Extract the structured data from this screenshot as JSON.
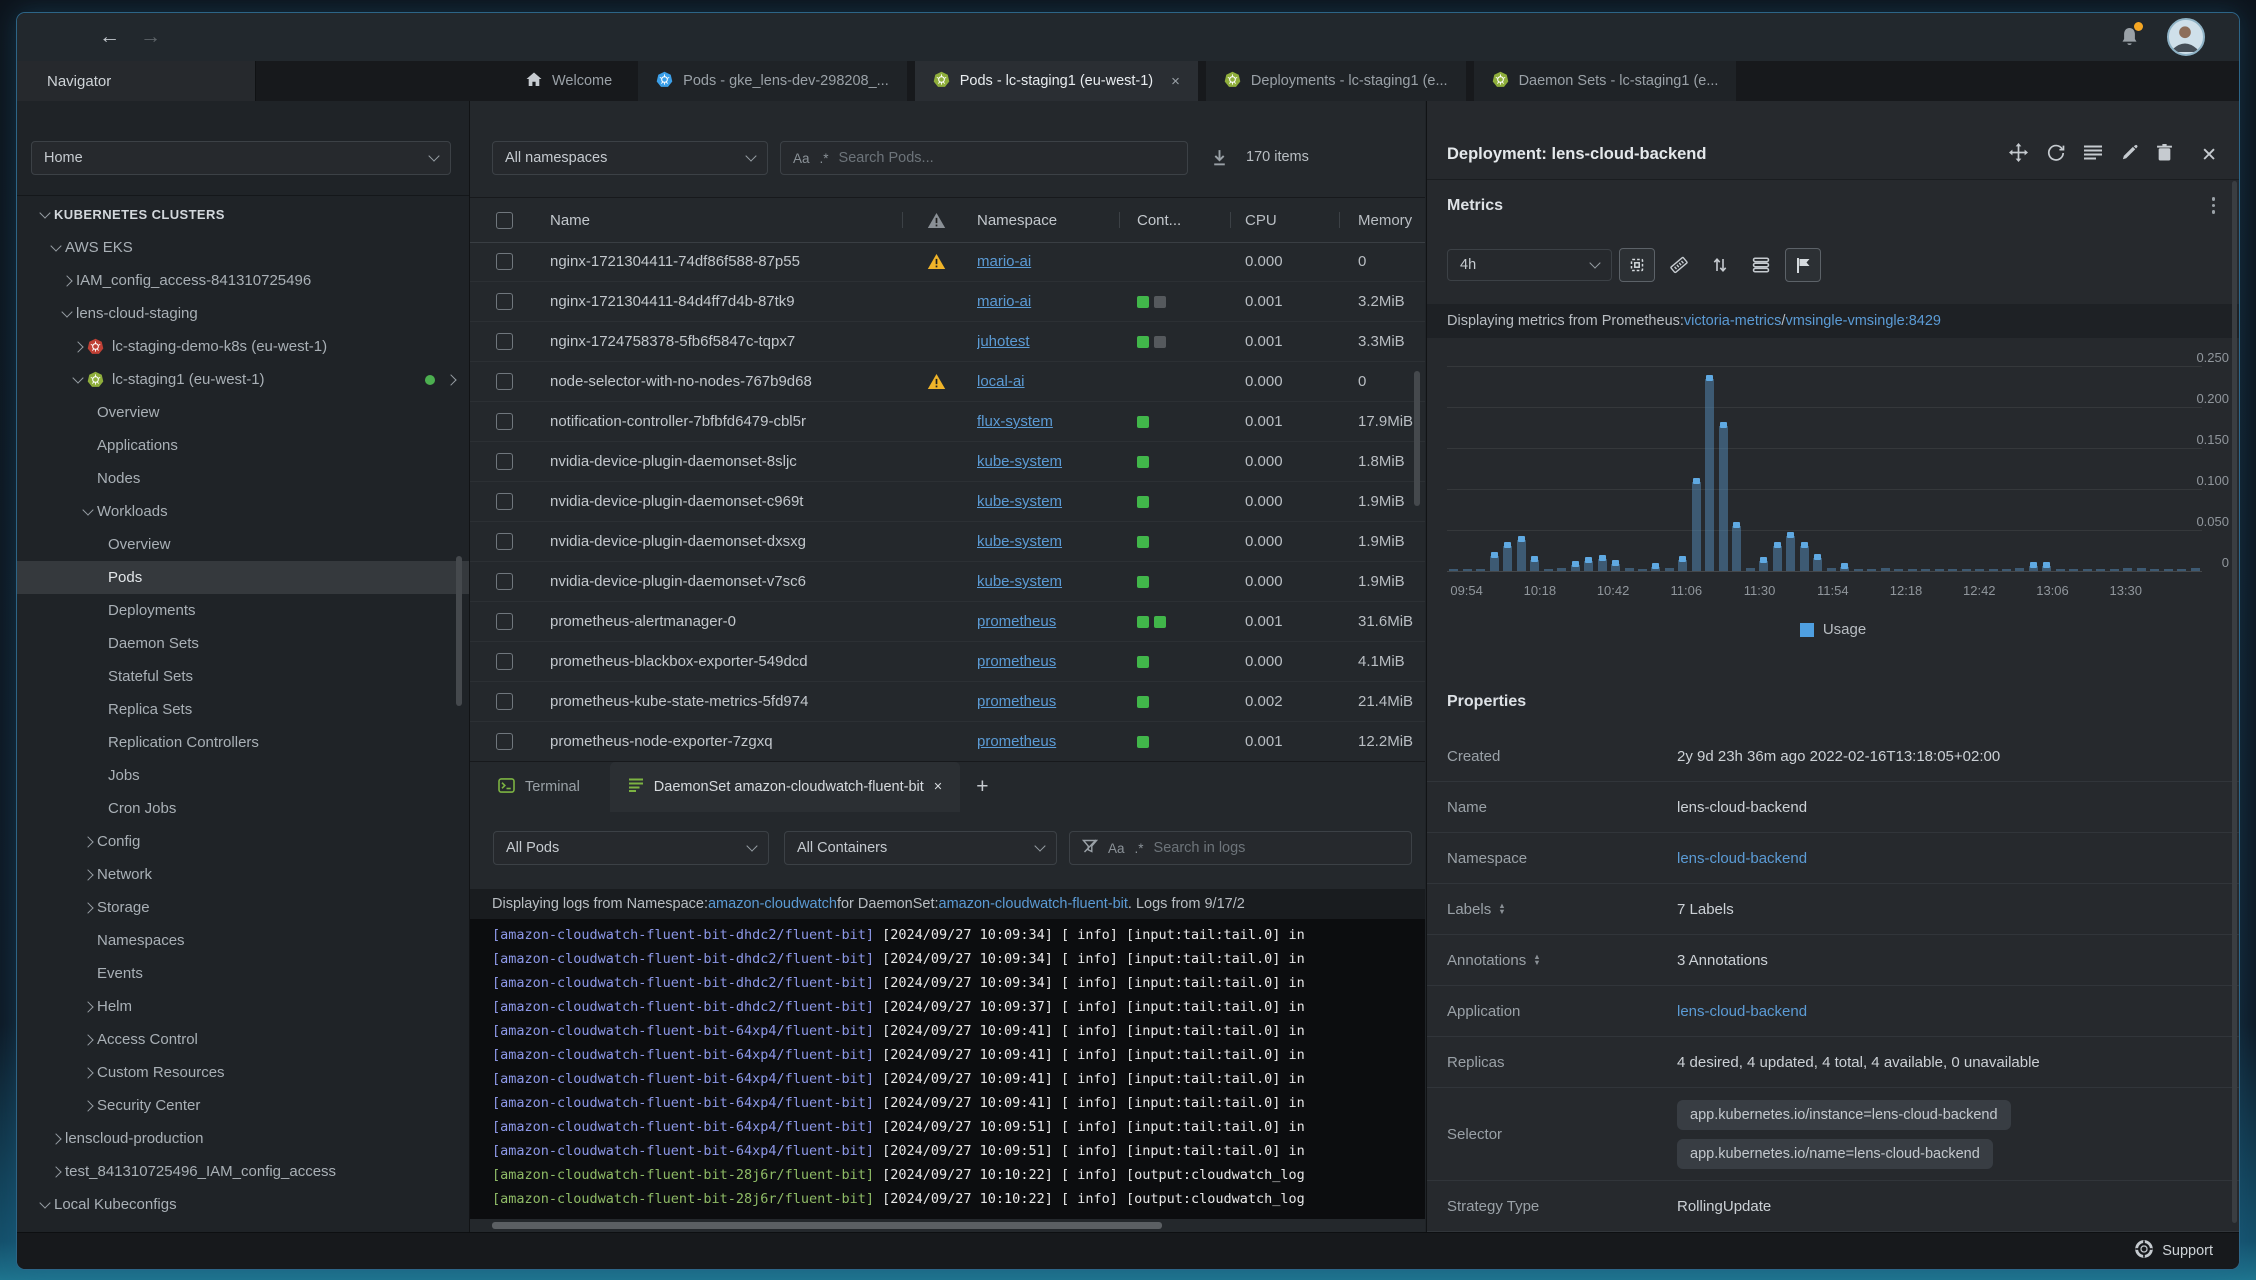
{
  "tabbar": {
    "navigator_label": "Navigator",
    "tabs": [
      {
        "label": "Welcome",
        "icon": "home",
        "icon_color": "#c6cbd0",
        "active": false,
        "closable": false,
        "plain": true
      },
      {
        "label": "Pods - gke_lens-dev-298208_...",
        "icon": "k8s",
        "icon_color": "#3b9fe8",
        "active": false,
        "closable": false,
        "plain": false
      },
      {
        "label": "Pods - lc-staging1 (eu-west-1)",
        "icon": "k8s",
        "icon_color": "#8fae3c",
        "active": true,
        "closable": true,
        "plain": false
      },
      {
        "label": "Deployments - lc-staging1 (e...",
        "icon": "k8s",
        "icon_color": "#8fae3c",
        "active": false,
        "closable": false,
        "plain": false
      },
      {
        "label": "Daemon Sets - lc-staging1 (e...",
        "icon": "k8s",
        "icon_color": "#8fae3c",
        "active": false,
        "closable": false,
        "plain": false
      }
    ]
  },
  "sidebar": {
    "selector_value": "Home",
    "tree": [
      {
        "label": "KUBERNETES CLUSTERS",
        "level": 0,
        "chevron": "down",
        "section": true
      },
      {
        "label": "AWS EKS",
        "level": 1,
        "chevron": "down"
      },
      {
        "label": "IAM_config_access-841310725496",
        "level": 2,
        "chevron": "right"
      },
      {
        "label": "lens-cloud-staging",
        "level": 2,
        "chevron": "down"
      },
      {
        "label": "lc-staging-demo-k8s (eu-west-1)",
        "level": 3,
        "chevron": "right",
        "icon": "k8s",
        "icon_color": "#bf4136"
      },
      {
        "label": "lc-staging1 (eu-west-1)",
        "level": 3,
        "chevron": "down",
        "icon": "k8s",
        "icon_color": "#8fae3c",
        "status_dot": "#4caf50",
        "trailing_chevron": true
      },
      {
        "label": "Overview",
        "level": 4
      },
      {
        "label": "Applications",
        "level": 4
      },
      {
        "label": "Nodes",
        "level": 4
      },
      {
        "label": "Workloads",
        "level": 4,
        "chevron": "down"
      },
      {
        "label": "Overview",
        "level": 5
      },
      {
        "label": "Pods",
        "level": 5,
        "selected": true
      },
      {
        "label": "Deployments",
        "level": 5
      },
      {
        "label": "Daemon Sets",
        "level": 5
      },
      {
        "label": "Stateful Sets",
        "level": 5
      },
      {
        "label": "Replica Sets",
        "level": 5
      },
      {
        "label": "Replication Controllers",
        "level": 5
      },
      {
        "label": "Jobs",
        "level": 5
      },
      {
        "label": "Cron Jobs",
        "level": 5
      },
      {
        "label": "Config",
        "level": 4,
        "chevron": "right"
      },
      {
        "label": "Network",
        "level": 4,
        "chevron": "right"
      },
      {
        "label": "Storage",
        "level": 4,
        "chevron": "right"
      },
      {
        "label": "Namespaces",
        "level": 4
      },
      {
        "label": "Events",
        "level": 4
      },
      {
        "label": "Helm",
        "level": 4,
        "chevron": "right"
      },
      {
        "label": "Access Control",
        "level": 4,
        "chevron": "right"
      },
      {
        "label": "Custom Resources",
        "level": 4,
        "chevron": "right"
      },
      {
        "label": "Security Center",
        "level": 4,
        "chevron": "right"
      },
      {
        "label": "lenscloud-production",
        "level": 1,
        "chevron": "right"
      },
      {
        "label": "test_841310725496_IAM_config_access",
        "level": 1,
        "chevron": "right"
      },
      {
        "label": "Local Kubeconfigs",
        "level": 0,
        "chevron": "down"
      }
    ]
  },
  "pods_panel": {
    "namespace_filter": "All namespaces",
    "match_case_label": "Aa",
    "regex_label": ".*",
    "search_placeholder": "Search Pods...",
    "items_count": "170 items",
    "columns": {
      "name": "Name",
      "namespace": "Namespace",
      "containers": "Cont...",
      "cpu": "CPU",
      "memory": "Memory"
    },
    "rows": [
      {
        "name": "nginx-1721304411-74df86f588-87p55",
        "warning": true,
        "namespace": "mario-ai",
        "containers": [],
        "cpu": "0.000",
        "memory": "0"
      },
      {
        "name": "nginx-1721304411-84d4ff7d4b-87tk9",
        "warning": false,
        "namespace": "mario-ai",
        "containers": [
          "green",
          "gray"
        ],
        "cpu": "0.001",
        "memory": "3.2MiB"
      },
      {
        "name": "nginx-1724758378-5fb6f5847c-tqpx7",
        "warning": false,
        "namespace": "juhotest",
        "containers": [
          "green",
          "gray"
        ],
        "cpu": "0.001",
        "memory": "3.3MiB"
      },
      {
        "name": "node-selector-with-no-nodes-767b9d68",
        "warning": true,
        "namespace": "local-ai",
        "containers": [],
        "cpu": "0.000",
        "memory": "0"
      },
      {
        "name": "notification-controller-7bfbfd6479-cbl5r",
        "warning": false,
        "namespace": "flux-system",
        "containers": [
          "green"
        ],
        "cpu": "0.001",
        "memory": "17.9MiB"
      },
      {
        "name": "nvidia-device-plugin-daemonset-8sljc",
        "warning": false,
        "namespace": "kube-system",
        "containers": [
          "green"
        ],
        "cpu": "0.000",
        "memory": "1.8MiB"
      },
      {
        "name": "nvidia-device-plugin-daemonset-c969t",
        "warning": false,
        "namespace": "kube-system",
        "containers": [
          "green"
        ],
        "cpu": "0.000",
        "memory": "1.9MiB"
      },
      {
        "name": "nvidia-device-plugin-daemonset-dxsxg",
        "warning": false,
        "namespace": "kube-system",
        "containers": [
          "green"
        ],
        "cpu": "0.000",
        "memory": "1.9MiB"
      },
      {
        "name": "nvidia-device-plugin-daemonset-v7sc6",
        "warning": false,
        "namespace": "kube-system",
        "containers": [
          "green"
        ],
        "cpu": "0.000",
        "memory": "1.9MiB"
      },
      {
        "name": "prometheus-alertmanager-0",
        "warning": false,
        "namespace": "prometheus",
        "containers": [
          "green",
          "green"
        ],
        "cpu": "0.001",
        "memory": "31.6MiB"
      },
      {
        "name": "prometheus-blackbox-exporter-549dcd",
        "warning": false,
        "namespace": "prometheus",
        "containers": [
          "green"
        ],
        "cpu": "0.000",
        "memory": "4.1MiB"
      },
      {
        "name": "prometheus-kube-state-metrics-5fd974",
        "warning": false,
        "namespace": "prometheus",
        "containers": [
          "green"
        ],
        "cpu": "0.002",
        "memory": "21.4MiB"
      },
      {
        "name": "prometheus-node-exporter-7zgxq",
        "warning": false,
        "namespace": "prometheus",
        "containers": [
          "green"
        ],
        "cpu": "0.001",
        "memory": "12.2MiB"
      }
    ]
  },
  "dock": {
    "tabs": [
      {
        "label": "Terminal",
        "icon": "terminal",
        "active": false,
        "closable": false
      },
      {
        "label": "DaemonSet amazon-cloudwatch-fluent-bit",
        "icon": "logs",
        "active": true,
        "closable": true
      }
    ],
    "new_tab_label": "+",
    "pods_filter": "All Pods",
    "containers_filter": "All Containers",
    "match_case_label": "Aa",
    "regex_label": ".*",
    "search_placeholder": "Search in logs",
    "info": {
      "prefix": "Displaying logs from Namespace: ",
      "namespace_link": "amazon-cloudwatch",
      "middle": " for DaemonSet: ",
      "daemonset_link": "amazon-cloudwatch-fluent-bit",
      "suffix": ". Logs from 9/17/2"
    },
    "log_lines": [
      {
        "pod": "[amazon-cloudwatch-fluent-bit-dhdc2/fluent-bit]",
        "pod_color": "#8d98e8",
        "message": " [2024/09/27 10:09:34] [ info] [input:tail:tail.0] in"
      },
      {
        "pod": "[amazon-cloudwatch-fluent-bit-dhdc2/fluent-bit]",
        "pod_color": "#8d98e8",
        "message": " [2024/09/27 10:09:34] [ info] [input:tail:tail.0] in"
      },
      {
        "pod": "[amazon-cloudwatch-fluent-bit-dhdc2/fluent-bit]",
        "pod_color": "#8d98e8",
        "message": " [2024/09/27 10:09:34] [ info] [input:tail:tail.0] in"
      },
      {
        "pod": "[amazon-cloudwatch-fluent-bit-dhdc2/fluent-bit]",
        "pod_color": "#8d98e8",
        "message": " [2024/09/27 10:09:37] [ info] [input:tail:tail.0] in"
      },
      {
        "pod": "[amazon-cloudwatch-fluent-bit-64xp4/fluent-bit]",
        "pod_color": "#8d98e8",
        "message": " [2024/09/27 10:09:41] [ info] [input:tail:tail.0] in"
      },
      {
        "pod": "[amazon-cloudwatch-fluent-bit-64xp4/fluent-bit]",
        "pod_color": "#8d98e8",
        "message": " [2024/09/27 10:09:41] [ info] [input:tail:tail.0] in"
      },
      {
        "pod": "[amazon-cloudwatch-fluent-bit-64xp4/fluent-bit]",
        "pod_color": "#8d98e8",
        "message": " [2024/09/27 10:09:41] [ info] [input:tail:tail.0] in"
      },
      {
        "pod": "[amazon-cloudwatch-fluent-bit-64xp4/fluent-bit]",
        "pod_color": "#8d98e8",
        "message": " [2024/09/27 10:09:41] [ info] [input:tail:tail.0] in"
      },
      {
        "pod": "[amazon-cloudwatch-fluent-bit-64xp4/fluent-bit]",
        "pod_color": "#8d98e8",
        "message": " [2024/09/27 10:09:51] [ info] [input:tail:tail.0] in"
      },
      {
        "pod": "[amazon-cloudwatch-fluent-bit-64xp4/fluent-bit]",
        "pod_color": "#8d98e8",
        "message": " [2024/09/27 10:09:51] [ info] [input:tail:tail.0] in"
      },
      {
        "pod": "[amazon-cloudwatch-fluent-bit-28j6r/fluent-bit]",
        "pod_color": "#8fbb66",
        "message": " [2024/09/27 10:10:22] [ info] [output:cloudwatch_log"
      },
      {
        "pod": "[amazon-cloudwatch-fluent-bit-28j6r/fluent-bit]",
        "pod_color": "#8fbb66",
        "message": " [2024/09/27 10:10:22] [ info] [output:cloudwatch_log"
      }
    ]
  },
  "details": {
    "title": "Deployment: lens-cloud-backend",
    "metrics": {
      "heading": "Metrics",
      "time_range": "4h",
      "source": {
        "prefix": "Displaying metrics from Prometheus: ",
        "provider_link": "victoria-metrics",
        "separator": " / ",
        "endpoint_link": "vmsingle-vmsingle:8429"
      },
      "legend_label": "Usage"
    },
    "properties": {
      "heading": "Properties",
      "rows": [
        {
          "label": "Created",
          "value": "2y 9d 23h 36m ago 2022-02-16T13:18:05+02:00"
        },
        {
          "label": "Name",
          "value": "lens-cloud-backend"
        },
        {
          "label": "Namespace",
          "value": "lens-cloud-backend",
          "link": true
        },
        {
          "label": "Labels",
          "value": "7 Labels",
          "sortable": true
        },
        {
          "label": "Annotations",
          "value": "3 Annotations",
          "sortable": true
        },
        {
          "label": "Application",
          "value": "lens-cloud-backend",
          "link": true
        },
        {
          "label": "Replicas",
          "value": "4 desired, 4 updated, 4 total, 4 available, 0 unavailable"
        },
        {
          "label": "Selector",
          "pills": [
            "app.kubernetes.io/instance=lens-cloud-backend",
            "app.kubernetes.io/name=lens-cloud-backend"
          ]
        },
        {
          "label": "Strategy Type",
          "value": "RollingUpdate"
        }
      ]
    }
  },
  "statusbar": {
    "support_label": "Support"
  },
  "chart_data": {
    "type": "bar",
    "series": [
      {
        "name": "Usage",
        "values": [
          0.002,
          0.003,
          0.002,
          0.018,
          0.03,
          0.038,
          0.013,
          0.003,
          0.004,
          0.007,
          0.012,
          0.015,
          0.008,
          0.004,
          0.003,
          0.005,
          0.004,
          0.013,
          0.108,
          0.234,
          0.177,
          0.055,
          0.004,
          0.012,
          0.031,
          0.043,
          0.03,
          0.016,
          0.004,
          0.005,
          0.003,
          0.003,
          0.004,
          0.003,
          0.002,
          0.003,
          0.002,
          0.003,
          0.002,
          0.003,
          0.002,
          0.003,
          0.004,
          0.006,
          0.006,
          0.003,
          0.002,
          0.003,
          0.002,
          0.003,
          0.004,
          0.004,
          0.002,
          0.003,
          0.003,
          0.004
        ]
      }
    ],
    "x_tick_labels": [
      "09:54",
      "10:18",
      "10:42",
      "11:06",
      "11:30",
      "11:54",
      "12:18",
      "12:42",
      "13:06",
      "13:30"
    ],
    "x_tick_fracs": [
      0.026,
      0.123,
      0.22,
      0.317,
      0.414,
      0.511,
      0.608,
      0.705,
      0.802,
      0.899
    ],
    "y_tick_labels": [
      "0.250",
      "0.200",
      "0.150",
      "0.100",
      "0.050",
      "0"
    ],
    "y_tick_values": [
      0.25,
      0.2,
      0.15,
      0.1,
      0.05,
      0
    ],
    "ylim": [
      0,
      0.25
    ],
    "grid": true,
    "legend_position": "bottom",
    "bar_color": "rgba(84,140,186,0.5)",
    "marker_color": "#5fa9e2"
  }
}
